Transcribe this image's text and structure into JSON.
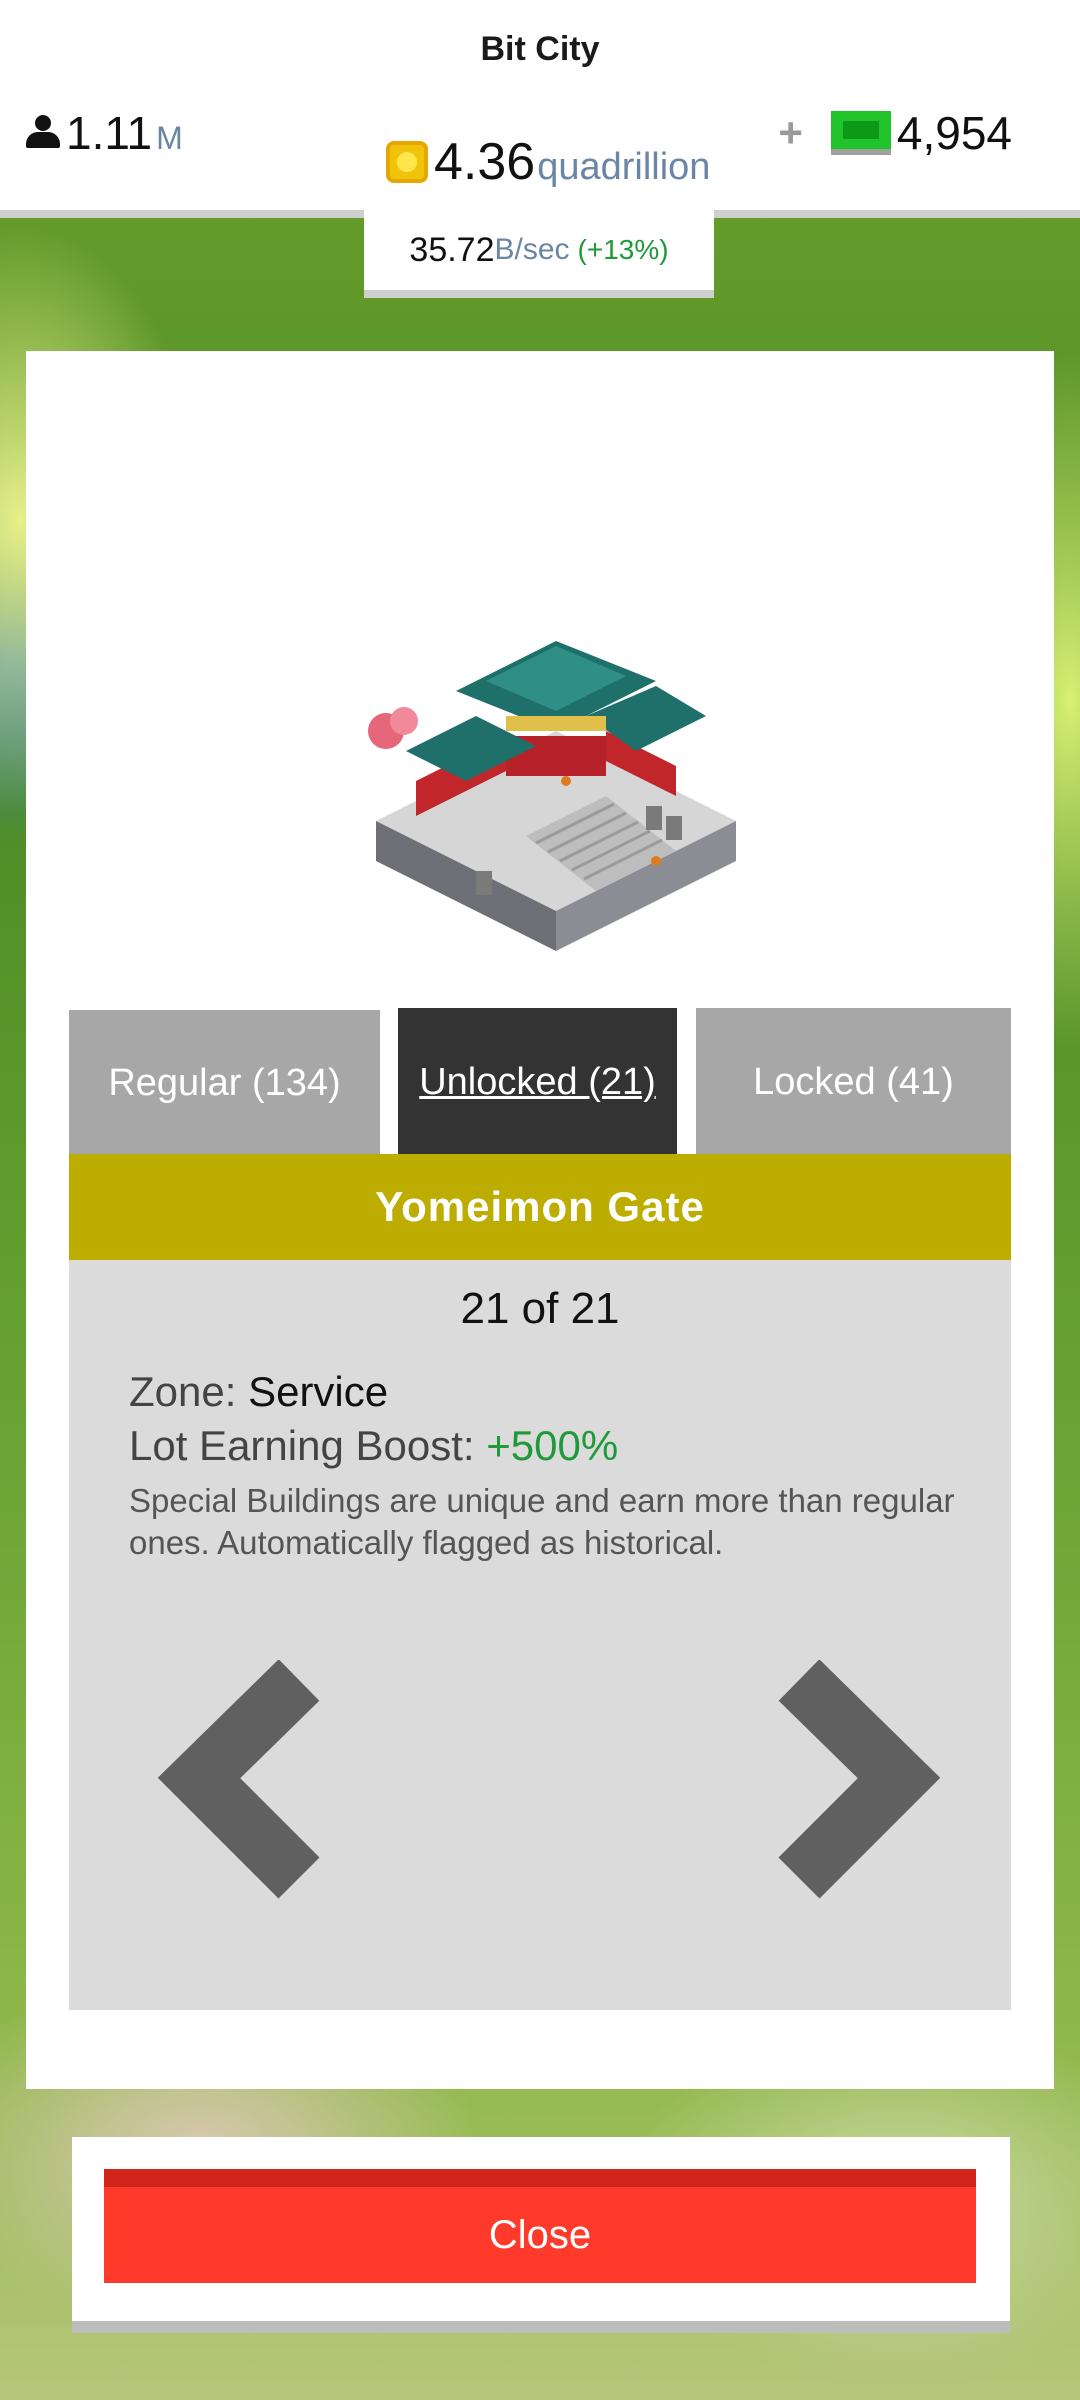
{
  "header": {
    "title": "Bit City",
    "population": {
      "value": "1.11",
      "unit": "M"
    },
    "coins": {
      "value": "4.36",
      "unit": "quadrillion"
    },
    "cash": {
      "plus": "+",
      "value": "4,954"
    },
    "rate": {
      "value": "35.72",
      "unit": "B/sec",
      "bonus": "(+13%)"
    }
  },
  "tabs": [
    {
      "label": "Regular (134)",
      "active": false
    },
    {
      "label": "Unlocked (21)",
      "active": true
    },
    {
      "label": "Locked (41)",
      "active": false
    }
  ],
  "building": {
    "name": "Yomeimon Gate",
    "counter": "21 of 21",
    "zone_label": "Zone: ",
    "zone_value": "Service",
    "boost_label": "Lot Earning Boost: ",
    "boost_value": "+500%",
    "description": "Special Buildings are unique and earn more than regular ones. Automatically flagged as historical."
  },
  "buttons": {
    "close": "Close"
  },
  "colors": {
    "name_bar": "#bcad00",
    "active_tab": "#333333",
    "inactive_tab": "#a7a7a7",
    "close": "#ff3a2a",
    "boost": "#1f9a3a"
  }
}
